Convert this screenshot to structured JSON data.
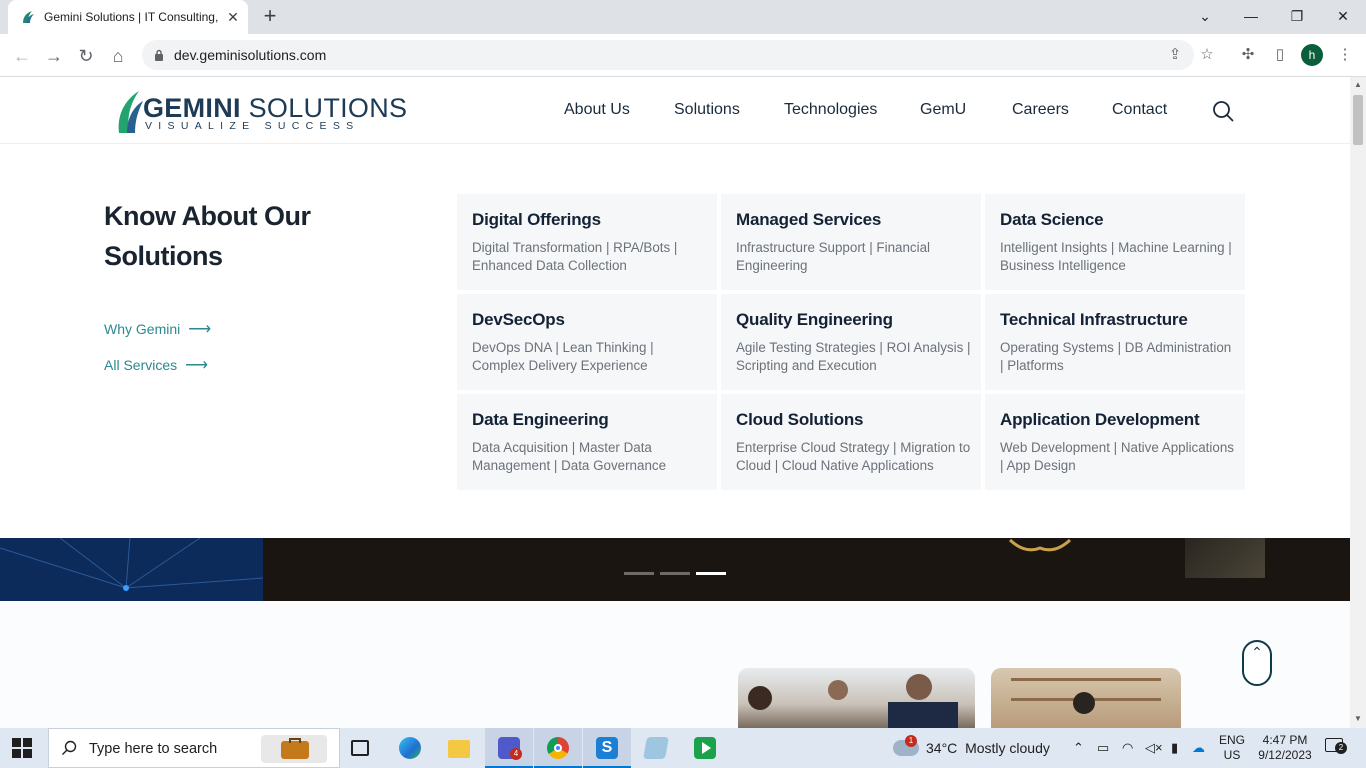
{
  "browser": {
    "tab_title": "Gemini Solutions | IT Consulting,",
    "url": "dev.geminisolutions.com",
    "profile_initial": "h"
  },
  "site": {
    "logo_word_bold": "GEMINI",
    "logo_word_rest": " SOLUTIONS",
    "logo_tagline": "VISUALIZE SUCCESS",
    "menu": [
      "About Us",
      "Solutions",
      "Technologies",
      "GemU",
      "Careers",
      "Contact"
    ]
  },
  "mega_menu": {
    "heading": "Know About Our Solutions",
    "links": [
      "Why Gemini",
      "All Services"
    ],
    "cards": [
      {
        "title": "Digital Offerings",
        "desc": "Digital Transformation | RPA/Bots | Enhanced Data Collection"
      },
      {
        "title": "Managed Services",
        "desc": "Infrastructure Support | Financial Engineering"
      },
      {
        "title": "Data Science",
        "desc": "Intelligent Insights | Machine Learning | Business Intelligence"
      },
      {
        "title": "DevSecOps",
        "desc": "DevOps DNA | Lean Thinking | Complex Delivery Experience"
      },
      {
        "title": "Quality Engineering",
        "desc": "Agile Testing Strategies | ROI Analysis | Scripting and Execution"
      },
      {
        "title": "Technical Infrastructure",
        "desc": "Operating Systems | DB Administration | Platforms"
      },
      {
        "title": "Data Engineering",
        "desc": "Data Acquisition | Master Data Management | Data Governance"
      },
      {
        "title": "Cloud Solutions",
        "desc": "Enterprise Cloud Strategy | Migration to Cloud | Cloud Native Applications"
      },
      {
        "title": "Application Development",
        "desc": "Web Development | Native Applications | App Design"
      }
    ]
  },
  "hero": {
    "slide_count": 3,
    "active_slide": 3
  },
  "taskbar": {
    "search_placeholder": "Type here to search",
    "teams_badge": "4",
    "weather_badge": "1",
    "temperature": "34°C",
    "weather_text": "Mostly cloudy",
    "lang_line1": "ENG",
    "lang_line2": "US",
    "time": "4:47 PM",
    "date": "9/12/2023",
    "notification_count": "2"
  },
  "colors": {
    "accent_teal": "#2b8a8f",
    "heading_dark": "#1a2430",
    "card_bg": "#f6f7f8"
  }
}
